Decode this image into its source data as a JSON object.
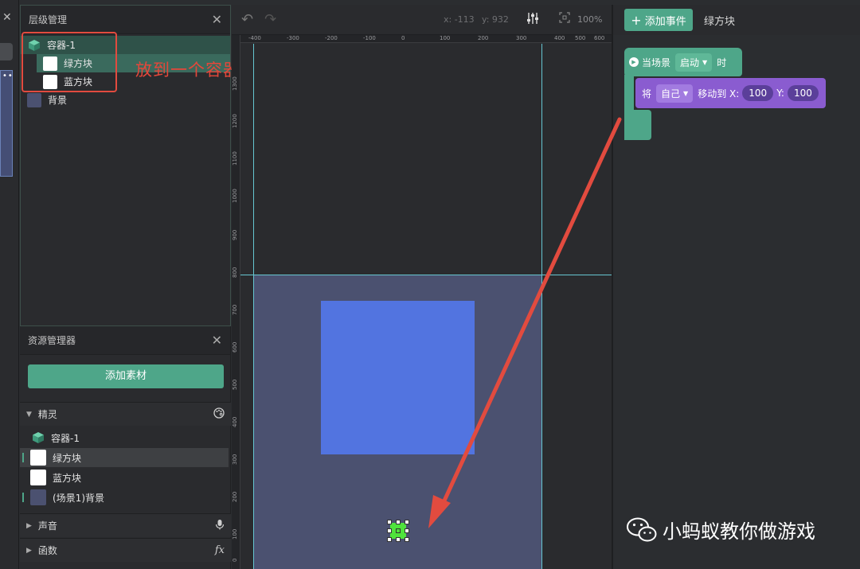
{
  "layer_panel": {
    "title": "层级管理",
    "items": [
      {
        "label": "容器-1"
      },
      {
        "label": "绿方块"
      },
      {
        "label": "蓝方块"
      },
      {
        "label": "背景"
      }
    ],
    "annotation": "放到一个容器下"
  },
  "asset_panel": {
    "title": "资源管理器",
    "add_button": "添加素材",
    "sections": {
      "sprites": "精灵",
      "sound": "声音",
      "functions": "函数"
    },
    "sprites": [
      {
        "label": "容器-1"
      },
      {
        "label": "绿方块"
      },
      {
        "label": "蓝方块"
      },
      {
        "label": "(场景1)背景"
      }
    ]
  },
  "scene_toolbar": {
    "x_coord": "x: -113",
    "y_coord": "y: 932",
    "zoom": "100%"
  },
  "ruler": {
    "top_labels": [
      "-400",
      "-300",
      "-200",
      "-100",
      "0",
      "100",
      "200",
      "300",
      "400",
      "500",
      "600"
    ],
    "left_labels": [
      "1300",
      "1200",
      "1100",
      "1000",
      "900",
      "800",
      "700",
      "600",
      "500",
      "400",
      "300",
      "200",
      "100",
      "0"
    ]
  },
  "event_panel": {
    "add_event": "添加事件",
    "target": "绿方块",
    "hat": {
      "prefix": "当场景",
      "option": "启动",
      "suffix": "时"
    },
    "move": {
      "prefix": "将",
      "target": "自己",
      "action": "移动到 X:",
      "x": "100",
      "y_label": "Y:",
      "y": "100"
    }
  },
  "watermark": "小蚂蚁教你做游戏",
  "colors": {
    "accent_green": "#4ea689",
    "annotation_red": "#e24b3f",
    "blue_square": "#5274e0",
    "scene_bg": "#4b5170",
    "guide": "#66c6d1",
    "motion_block": "#8a5cd0"
  }
}
